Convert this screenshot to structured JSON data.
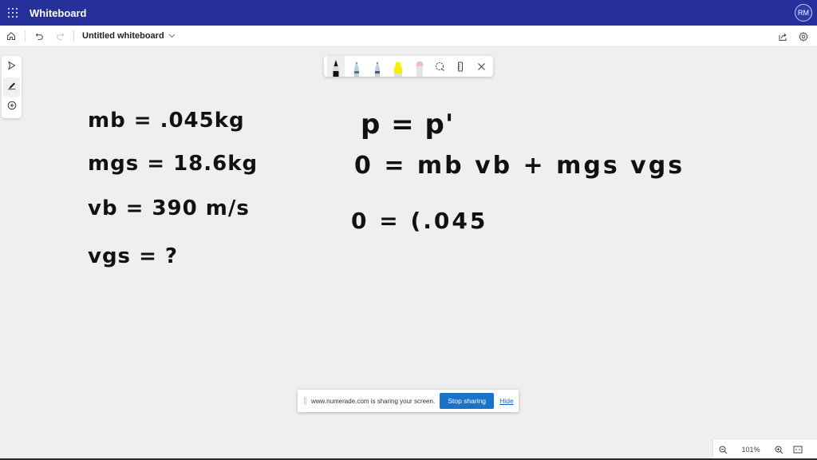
{
  "titlebar": {
    "app_title": "Whiteboard",
    "avatar_initials": "RM",
    "brand_color": "#25309b"
  },
  "commandbar": {
    "doc_title": "Untitled whiteboard",
    "icons": [
      "home-icon",
      "undo-icon",
      "redo-icon",
      "chevron-down-icon",
      "share-icon",
      "settings-icon"
    ]
  },
  "rail": {
    "tools": [
      {
        "name": "select",
        "icon": "pointer-icon",
        "active": false
      },
      {
        "name": "inking",
        "icon": "pen-icon",
        "active": true
      },
      {
        "name": "add",
        "icon": "plus-circle-icon",
        "active": false
      }
    ]
  },
  "inkbar": {
    "pens": [
      {
        "name": "black-pen",
        "color": "#111111",
        "active": true
      },
      {
        "name": "teal-pen",
        "color": "#2a8a9a",
        "active": false
      },
      {
        "name": "blue-pen",
        "color": "#3a5aa0",
        "active": false
      },
      {
        "name": "yellow-highlighter",
        "color": "#f5f000",
        "active": false
      },
      {
        "name": "eraser",
        "color": "#f0b8c4",
        "active": false
      }
    ],
    "icons": [
      "lasso-icon",
      "ruler-icon",
      "close-icon"
    ]
  },
  "canvas": {
    "left_column": [
      "mb = .045kg",
      "mgs = 18.6kg",
      "vb = 390 m/s",
      "vgs = ?"
    ],
    "right_column": [
      "p = p'",
      "0 = mb vb + mgs vgs",
      "0 = (.045"
    ]
  },
  "share_banner": {
    "message": "www.numerade.com is sharing your screen.",
    "stop_label": "Stop sharing",
    "hide_label": "Hide"
  },
  "zoombar": {
    "zoom_level": "101%"
  }
}
